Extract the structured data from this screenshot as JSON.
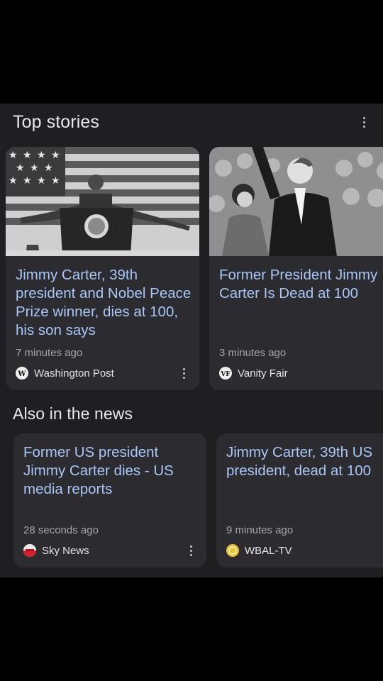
{
  "top_stories": {
    "title": "Top stories",
    "cards": [
      {
        "headline": "Jimmy Carter, 39th president and Nobel Peace Prize winner, dies at 100, his son says",
        "time": "7 minutes ago",
        "source": "Washington Post",
        "icon": "washington-post-logo-icon"
      },
      {
        "headline": "Former President Jimmy Carter Is Dead at 100",
        "time": "3 minutes ago",
        "source": "Vanity Fair",
        "icon": "vanity-fair-logo-icon"
      }
    ]
  },
  "also_in_news": {
    "title": "Also in the news",
    "cards": [
      {
        "headline": "Former US president Jimmy Carter dies - US media reports",
        "time": "28 seconds ago",
        "source": "Sky News",
        "icon": "sky-news-logo-icon"
      },
      {
        "headline": "Jimmy Carter, 39th US president, dead at 100",
        "time": "9 minutes ago",
        "source": "WBAL-TV",
        "icon": "wbal-tv-logo-icon"
      }
    ]
  },
  "colors": {
    "background": "#000000",
    "panel": "#1f1f21",
    "card": "#2c2c30",
    "headline": "#a8c6f6",
    "meta": "#a6a6a6"
  }
}
